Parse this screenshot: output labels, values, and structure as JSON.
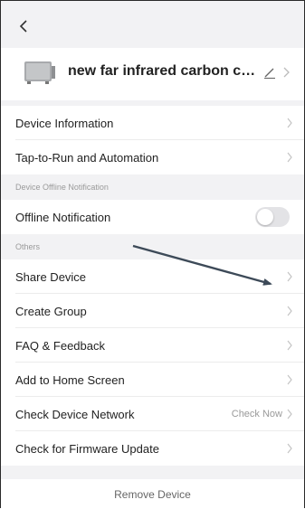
{
  "header": {
    "device_name": "new far infrared carbon cryst..."
  },
  "rows": {
    "device_information": "Device Information",
    "tap_to_run": "Tap-to-Run and Automation",
    "offline_notification": "Offline Notification",
    "share_device": "Share Device",
    "create_group": "Create Group",
    "faq_feedback": "FAQ & Feedback",
    "add_to_home": "Add to Home Screen",
    "check_network": "Check Device Network",
    "check_network_action": "Check Now",
    "check_firmware": "Check for Firmware Update"
  },
  "sections": {
    "offline": "Device Offline Notification",
    "others": "Others"
  },
  "toggles": {
    "offline_notification_on": false
  },
  "footer": {
    "remove_device": "Remove Device"
  },
  "colors": {
    "background": "#f2f2f4",
    "card": "#ffffff",
    "secondary_text": "#9a9a9a",
    "arrow": "#3d4a58"
  },
  "icons": [
    "back-chevron-icon",
    "device-thumbnail-icon",
    "edit-pencil-icon",
    "chevron-right-icon",
    "annotation-arrow-icon"
  ]
}
